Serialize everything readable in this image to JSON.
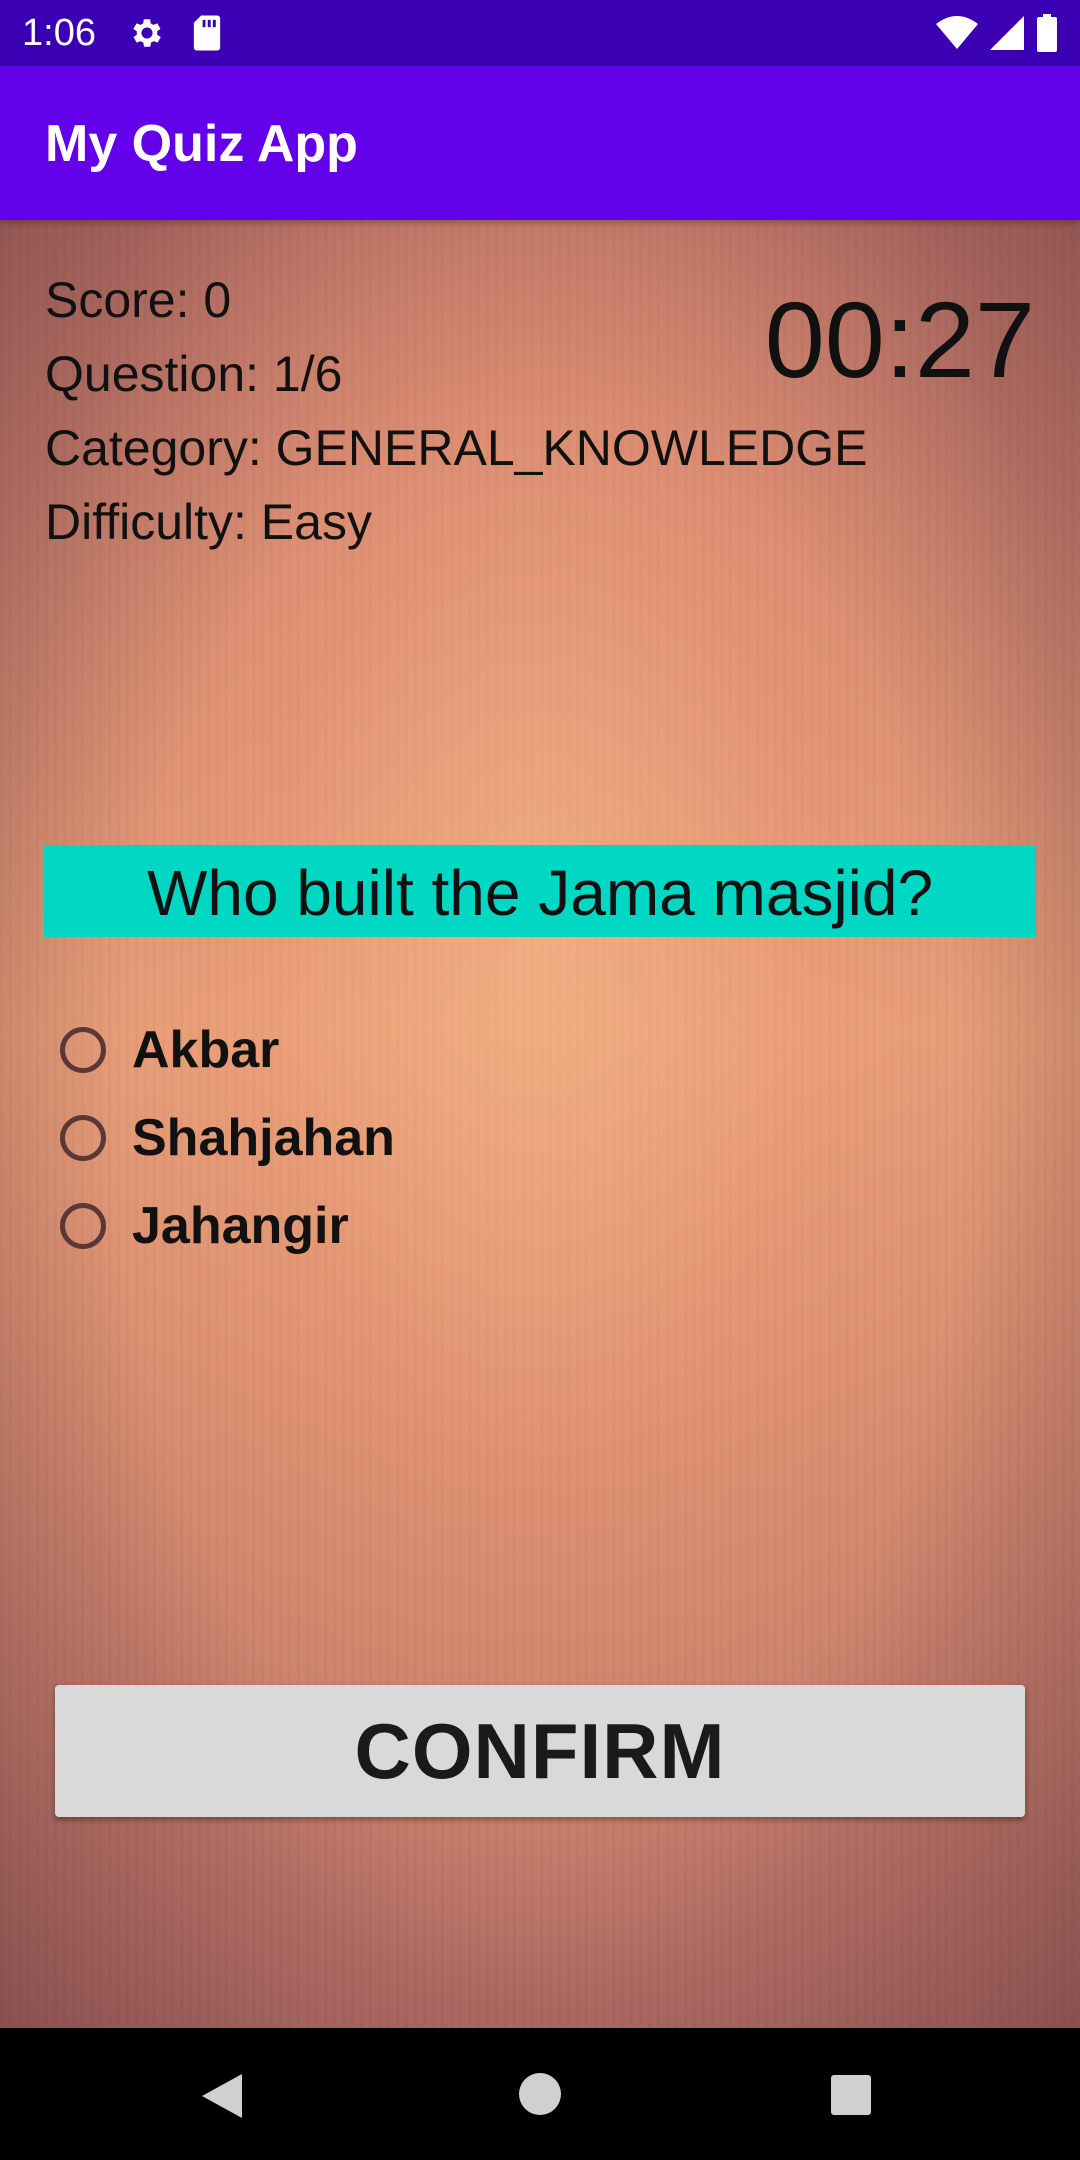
{
  "status_bar": {
    "time": "1:06",
    "icons": [
      "gear-icon",
      "sd-card-icon",
      "wifi-icon",
      "signal-icon",
      "battery-icon"
    ],
    "background": "#3c00b4"
  },
  "app_bar": {
    "title": "My Quiz App",
    "background": "#6200ea"
  },
  "quiz": {
    "score": "Score: 0",
    "question_count": "Question: 1/6",
    "category": "Category: GENERAL_KNOWLEDGE",
    "difficulty": "Difficulty: Easy",
    "timer": "00:27",
    "question": "Who built the Jama masjid?",
    "question_background": "#00d8c4",
    "options": [
      {
        "label": "Akbar"
      },
      {
        "label": "Shahjahan"
      },
      {
        "label": "Jahangir"
      }
    ],
    "confirm_label": "CONFIRM"
  },
  "nav_bar": {
    "icons": [
      "back-icon",
      "home-icon",
      "recents-icon"
    ]
  }
}
